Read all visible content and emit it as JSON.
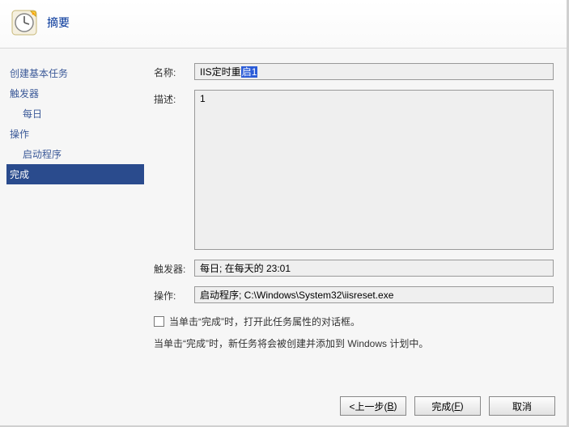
{
  "header": {
    "title": "摘要"
  },
  "sidebar": {
    "items": [
      {
        "label": "创建基本任务",
        "sub": false,
        "active": false
      },
      {
        "label": "触发器",
        "sub": false,
        "active": false
      },
      {
        "label": "每日",
        "sub": true,
        "active": false
      },
      {
        "label": "操作",
        "sub": false,
        "active": false
      },
      {
        "label": "启动程序",
        "sub": true,
        "active": false
      },
      {
        "label": "完成",
        "sub": false,
        "active": true
      }
    ]
  },
  "form": {
    "name_label": "名称:",
    "name_value_prefix": "IIS定时重",
    "name_value_selected": "启1",
    "desc_label": "描述:",
    "desc_value": "1",
    "trigger_label": "触发器:",
    "trigger_value": "每日; 在每天的 23:01",
    "action_label": "操作:",
    "action_value": "启动程序; C:\\Windows\\System32\\iisreset.exe"
  },
  "hints": {
    "checkbox_label": "当单击“完成”时，打开此任务属性的对话框。",
    "finish_note": "当单击“完成”时，新任务将会被创建并添加到 Windows 计划中。"
  },
  "buttons": {
    "back": {
      "text": "<上一步(",
      "mnemonic": "B",
      "suffix": ")"
    },
    "finish": {
      "text": "完成(",
      "mnemonic": "F",
      "suffix": ")"
    },
    "cancel": {
      "text": "取消"
    }
  }
}
